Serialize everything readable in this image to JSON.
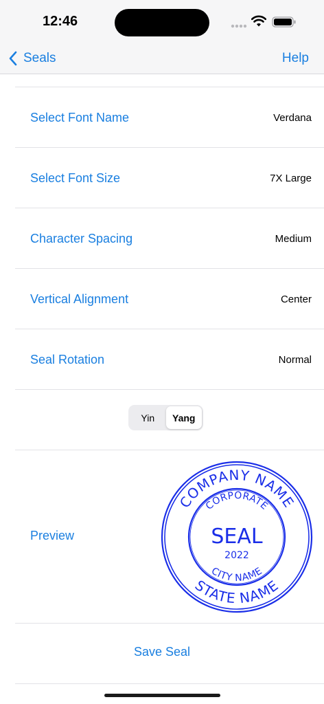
{
  "status_bar": {
    "time": "12:46"
  },
  "nav": {
    "back_label": "Seals",
    "help_label": "Help"
  },
  "settings": [
    {
      "label": "Select Font Name",
      "value": "Verdana"
    },
    {
      "label": "Select Font Size",
      "value": "7X Large"
    },
    {
      "label": "Character Spacing",
      "value": "Medium"
    },
    {
      "label": "Vertical Alignment",
      "value": "Center"
    },
    {
      "label": "Seal Rotation",
      "value": "Normal"
    }
  ],
  "style_toggle": {
    "options": [
      "Yin",
      "Yang"
    ],
    "selected": "Yang"
  },
  "preview": {
    "label": "Preview",
    "seal": {
      "outer_top": "COMPANY NAME",
      "outer_bottom": "STATE NAME",
      "inner_top": "CORPORATE",
      "inner_bottom": "CITY NAME",
      "center": "SEAL",
      "year": "2022",
      "color": "#1a2ee8"
    }
  },
  "save_label": "Save Seal",
  "colors": {
    "accent": "#1a7fe0",
    "seal": "#1a2ee8"
  }
}
